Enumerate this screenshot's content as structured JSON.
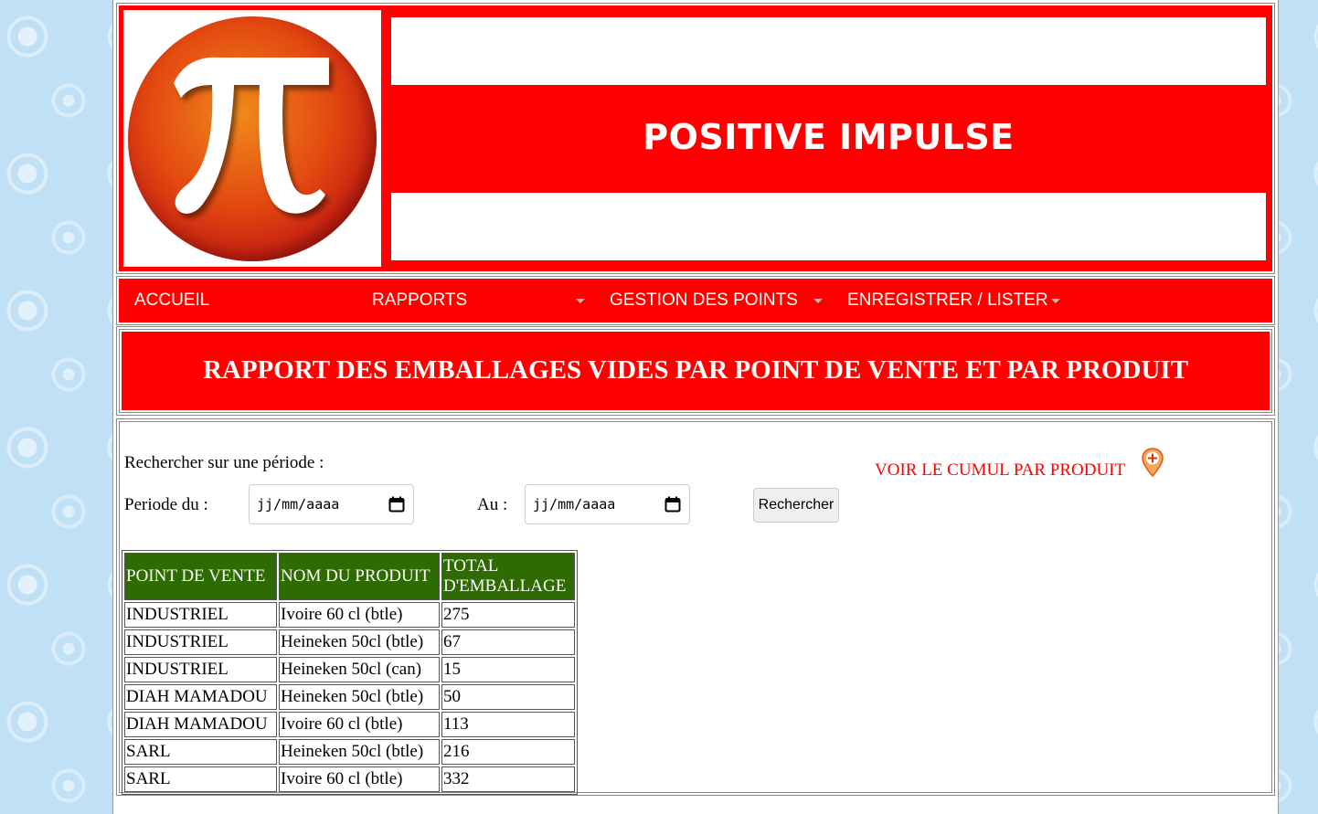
{
  "header": {
    "site_title": "POSITIVE IMPULSE"
  },
  "nav": {
    "items": [
      {
        "label": "ACCUEIL"
      },
      {
        "label": "RAPPORTS"
      },
      {
        "label": "GESTION DES POINTS"
      },
      {
        "label": "ENREGISTRER / LISTER"
      }
    ]
  },
  "report": {
    "title": "RAPPORT DES EMBALLAGES VIDES PAR POINT DE VENTE ET PAR PRODUIT"
  },
  "search": {
    "period_label": "Rechercher sur une période :",
    "from_label": "Periode du :",
    "to_label": "Au :",
    "date_placeholder": "jj/mm/aaaa",
    "button_label": "Rechercher",
    "cumul_link": "VOIR LE CUMUL PAR PRODUIT"
  },
  "table": {
    "headers": [
      "POINT DE VENTE",
      "NOM DU PRODUIT",
      "TOTAL D'EMBALLAGE"
    ],
    "rows": [
      [
        "INDUSTRIEL",
        "Ivoire 60 cl (btle)",
        "275"
      ],
      [
        "INDUSTRIEL",
        "Heineken 50cl (btle)",
        "67"
      ],
      [
        "INDUSTRIEL",
        "Heineken 50cl (can)",
        "15"
      ],
      [
        "DIAH MAMADOU",
        "Heineken 50cl (btle)",
        "50"
      ],
      [
        "DIAH MAMADOU",
        "Ivoire 60 cl (btle)",
        "113"
      ],
      [
        "SARL",
        "Heineken 50cl (btle)",
        "216"
      ],
      [
        "SARL",
        "Ivoire 60 cl (btle)",
        "332"
      ]
    ]
  },
  "colors": {
    "brand_red": "#ff0000",
    "table_header": "#2e6b00",
    "page_bg": "#bfe0f5"
  },
  "icons": {
    "logo": "pi-logo",
    "calendar": "calendar-icon",
    "pin": "map-pin-plus-icon",
    "caret": "caret-down-icon"
  }
}
